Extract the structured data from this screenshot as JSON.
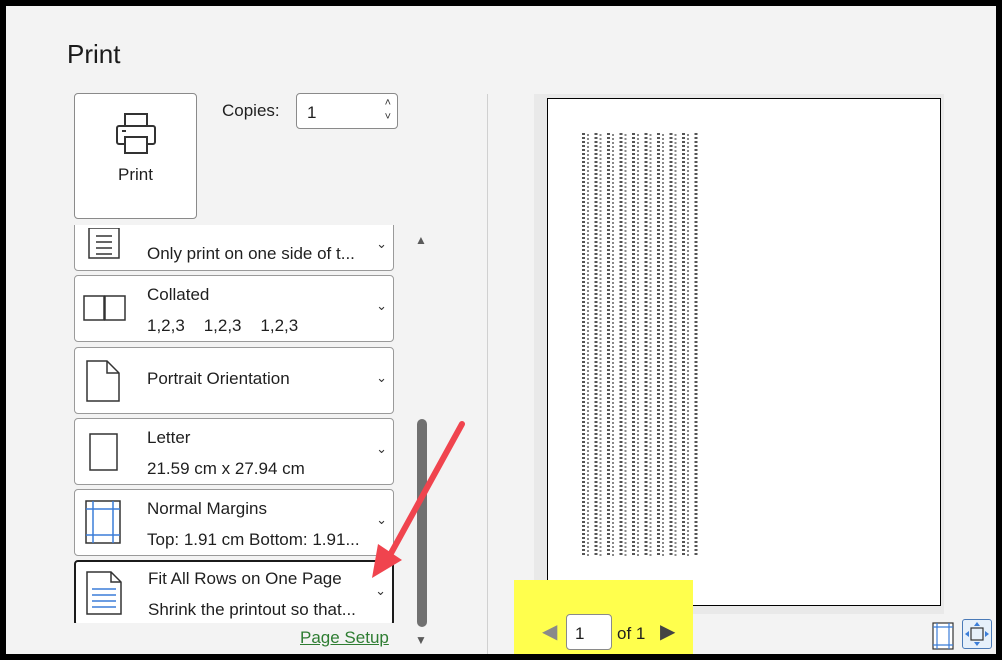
{
  "header": {
    "title": "Print"
  },
  "print_button": {
    "label": "Print"
  },
  "copies": {
    "label": "Copies:",
    "value": "1"
  },
  "settings": [
    {
      "id": "sides",
      "line1": "Only print on one side of t...",
      "line2": ""
    },
    {
      "id": "collate",
      "line1": "Collated",
      "line2": "1,2,3    1,2,3    1,2,3"
    },
    {
      "id": "orientation",
      "line1": "Portrait Orientation",
      "line2": ""
    },
    {
      "id": "paper",
      "line1": "Letter",
      "line2": "21.59 cm x 27.94 cm"
    },
    {
      "id": "margins",
      "line1": "Normal Margins",
      "line2": "Top: 1.91 cm Bottom: 1.91..."
    },
    {
      "id": "scaling",
      "line1": "Fit All Rows on One Page",
      "line2": "Shrink the printout so that..."
    }
  ],
  "page_setup_link": "Page Setup",
  "preview_nav": {
    "current_page": "1",
    "of_label": "of 1"
  },
  "colors": {
    "accent_blue": "#3b7dd8",
    "highlight": "#ffff4d",
    "arrow": "#f0444e",
    "link_green": "#2e7d32"
  },
  "icons": [
    "printer-icon",
    "one-sided-icon",
    "collated-icon",
    "portrait-icon",
    "paper-size-icon",
    "margins-icon",
    "scaling-icon",
    "show-margins-icon",
    "zoom-to-page-icon"
  ]
}
